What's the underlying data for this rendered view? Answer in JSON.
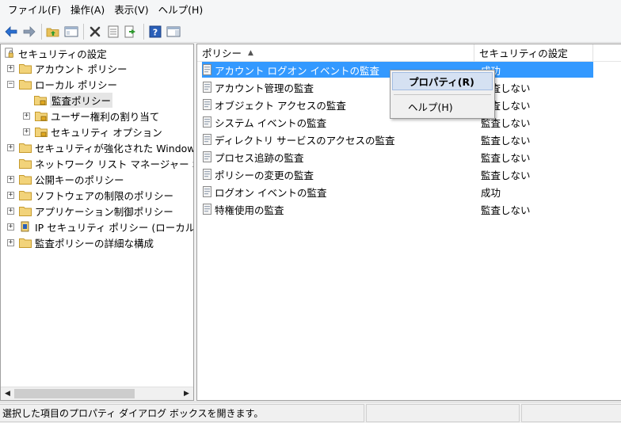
{
  "menu": [
    "ファイル(F)",
    "操作(A)",
    "表示(V)",
    "ヘルプ(H)"
  ],
  "toolbar": {
    "icons": [
      "back-icon",
      "forward-icon",
      "up-folder-icon",
      "show-hide-tree-icon",
      "delete-icon",
      "properties-icon",
      "export-list-icon",
      "help-icon",
      "action-pane-icon"
    ]
  },
  "tree": {
    "root": "セキュリティの設定",
    "items": [
      {
        "label": "アカウント ポリシー"
      },
      {
        "label": "ローカル ポリシー"
      },
      {
        "label": "監査ポリシー"
      },
      {
        "label": "ユーザー権利の割り当て"
      },
      {
        "label": "セキュリティ オプション"
      },
      {
        "label": "セキュリティが強化された Windows"
      },
      {
        "label": "ネットワーク リスト マネージャー ポ"
      },
      {
        "label": "公開キーのポリシー"
      },
      {
        "label": "ソフトウェアの制限のポリシー"
      },
      {
        "label": "アプリケーション制御ポリシー"
      },
      {
        "label": "IP セキュリティ ポリシー (ローカル"
      },
      {
        "label": "監査ポリシーの詳細な構成"
      }
    ]
  },
  "list": {
    "columns": [
      "ポリシー",
      "セキュリティの設定"
    ],
    "sort_indicator": "▲",
    "rows": [
      {
        "name": "アカウント ログオン イベントの監査",
        "setting": "成功"
      },
      {
        "name": "アカウント管理の監査",
        "setting": "監査しない"
      },
      {
        "name": "オブジェクト アクセスの監査",
        "setting": "監査しない"
      },
      {
        "name": "システム イベントの監査",
        "setting": "監査しない"
      },
      {
        "name": "ディレクトリ サービスのアクセスの監査",
        "setting": "監査しない"
      },
      {
        "name": "プロセス追跡の監査",
        "setting": "監査しない"
      },
      {
        "name": "ポリシーの変更の監査",
        "setting": "監査しない"
      },
      {
        "name": "ログオン イベントの監査",
        "setting": "成功"
      },
      {
        "name": "特権使用の監査",
        "setting": "監査しない"
      }
    ]
  },
  "context_menu": {
    "properties": "プロパティ(R)",
    "help": "ヘルプ(H)"
  },
  "status": {
    "text": "選択した項目のプロパティ ダイアログ ボックスを開きます。"
  },
  "colors": {
    "selection": "#3399ff",
    "folder": "#e8c15a",
    "accent_blue": "#2a6fd1"
  }
}
